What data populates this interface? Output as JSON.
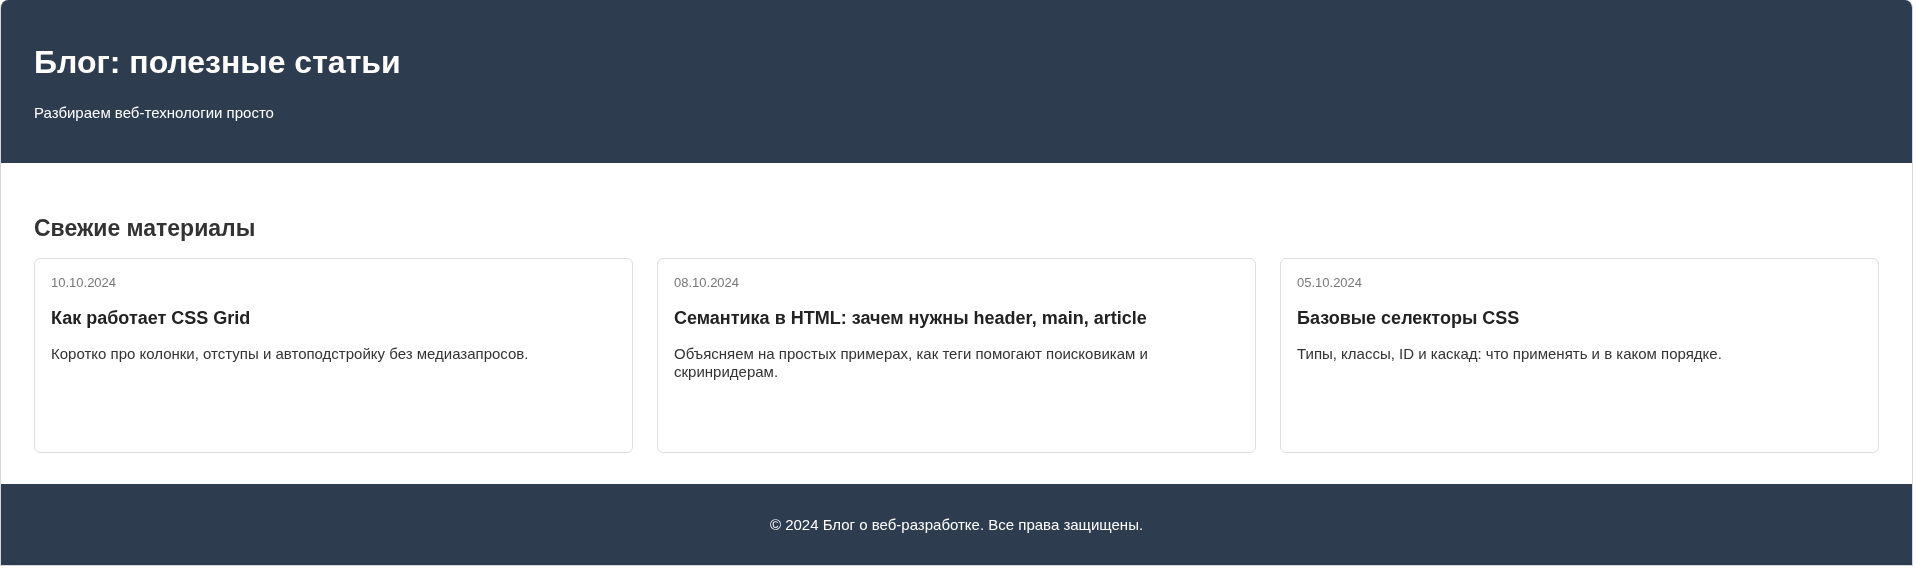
{
  "header": {
    "title": "Блог: полезные статьи",
    "subtitle": "Разбираем веб-технологии просто"
  },
  "section": {
    "title": "Свежие материалы"
  },
  "articles": [
    {
      "date": "10.10.2024",
      "title": "Как работает CSS Grid",
      "summary": "Коротко про колонки, отступы и автоподстройку без медиазапросов."
    },
    {
      "date": "08.10.2024",
      "title": "Семантика в HTML: зачем нужны header, main, article",
      "summary": "Объясняем на простых примерах, как теги помогают поисковикам и скринридерам."
    },
    {
      "date": "05.10.2024",
      "title": "Базовые селекторы CSS",
      "summary": "Типы, классы, ID и каскад: что применять и в каком порядке."
    }
  ],
  "footer": {
    "text": "© 2024 Блог о веб-разработке. Все права защищены."
  }
}
